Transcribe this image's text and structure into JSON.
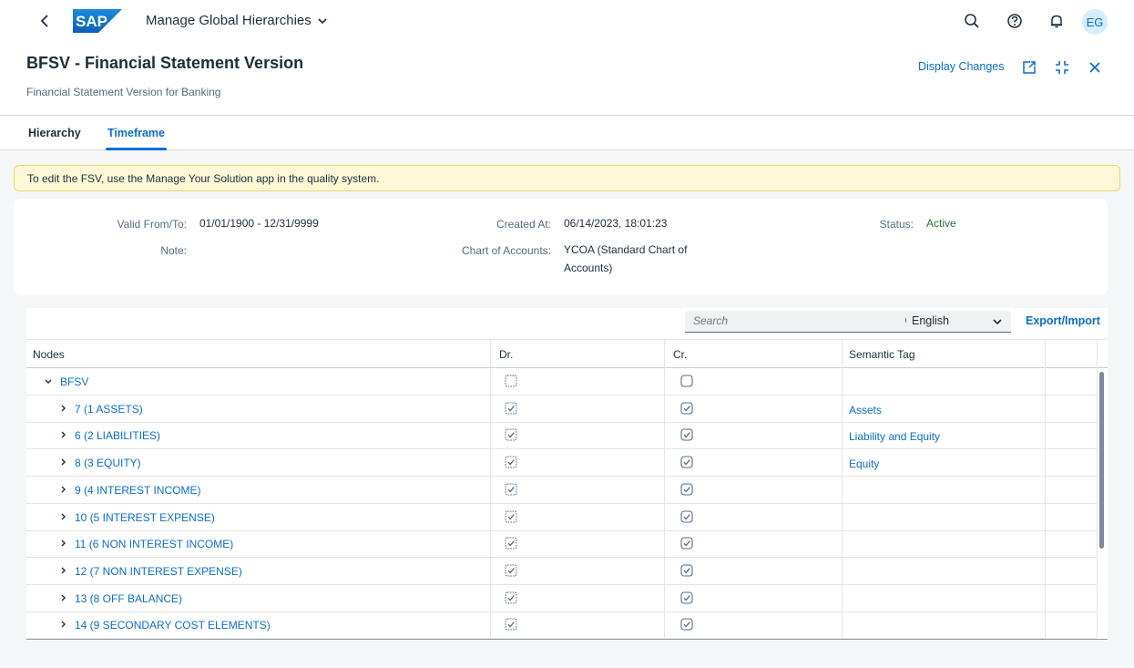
{
  "shell": {
    "logo_text": "SAP",
    "app_title": "Manage Global Hierarchies",
    "avatar_initials": "EG"
  },
  "header": {
    "title": "BFSV - Financial Statement Version",
    "subtitle": "Financial Statement Version for Banking",
    "display_changes_label": "Display Changes"
  },
  "tabs": [
    {
      "label": "Hierarchy",
      "selected": false
    },
    {
      "label": "Timeframe",
      "selected": true
    }
  ],
  "message": "To edit the FSV, use the Manage Your Solution app in the quality system.",
  "info": {
    "valid_label": "Valid From/To:",
    "valid_value": "01/01/1900 - 12/31/9999",
    "note_label": "Note:",
    "created_label": "Created At:",
    "created_value": "06/14/2023, 18:01:23",
    "coa_label": "Chart of Accounts:",
    "coa_value_line1": "YCOA (Standard Chart of",
    "coa_value_line2": "Accounts)",
    "status_label": "Status:",
    "status_value": "Active"
  },
  "toolbar": {
    "search_placeholder": "Search",
    "language_selected": "English",
    "export_label": "Export/Import"
  },
  "table": {
    "columns": [
      "Nodes",
      "Dr.",
      "Cr.",
      "Semantic Tag"
    ],
    "rows": [
      {
        "label": "BFSV",
        "level": 0,
        "expanded": true,
        "dr": false,
        "cr": false,
        "tag": ""
      },
      {
        "label": "7 (1 ASSETS)",
        "level": 1,
        "expanded": false,
        "dr": true,
        "cr": true,
        "tag": "Assets"
      },
      {
        "label": "6 (2 LIABILITIES)",
        "level": 1,
        "expanded": false,
        "dr": true,
        "cr": true,
        "tag": "Liability and Equity"
      },
      {
        "label": "8 (3 EQUITY)",
        "level": 1,
        "expanded": false,
        "dr": true,
        "cr": true,
        "tag": "Equity"
      },
      {
        "label": "9 (4 INTEREST INCOME)",
        "level": 1,
        "expanded": false,
        "dr": true,
        "cr": true,
        "tag": ""
      },
      {
        "label": "10 (5 INTEREST EXPENSE)",
        "level": 1,
        "expanded": false,
        "dr": true,
        "cr": true,
        "tag": ""
      },
      {
        "label": "11 (6 NON INTEREST INCOME)",
        "level": 1,
        "expanded": false,
        "dr": true,
        "cr": true,
        "tag": ""
      },
      {
        "label": "12 (7 NON INTEREST EXPENSE)",
        "level": 1,
        "expanded": false,
        "dr": true,
        "cr": true,
        "tag": ""
      },
      {
        "label": "13 (8 OFF BALANCE)",
        "level": 1,
        "expanded": false,
        "dr": true,
        "cr": true,
        "tag": ""
      },
      {
        "label": "14 (9 SECONDARY COST ELEMENTS)",
        "level": 1,
        "expanded": false,
        "dr": true,
        "cr": true,
        "tag": ""
      }
    ]
  },
  "colors": {
    "brand_blue": "#0a6ed1",
    "text_dark": "#1d2d3e",
    "status_green": "#256f3a",
    "message_bg": "#fff8d6"
  },
  "icons": {
    "back": "chevron-left-icon",
    "search": "search-icon",
    "help": "help-icon",
    "notifications": "bell-icon",
    "share": "share-icon",
    "fullscreen": "exit-fullscreen-icon",
    "close": "close-icon"
  }
}
